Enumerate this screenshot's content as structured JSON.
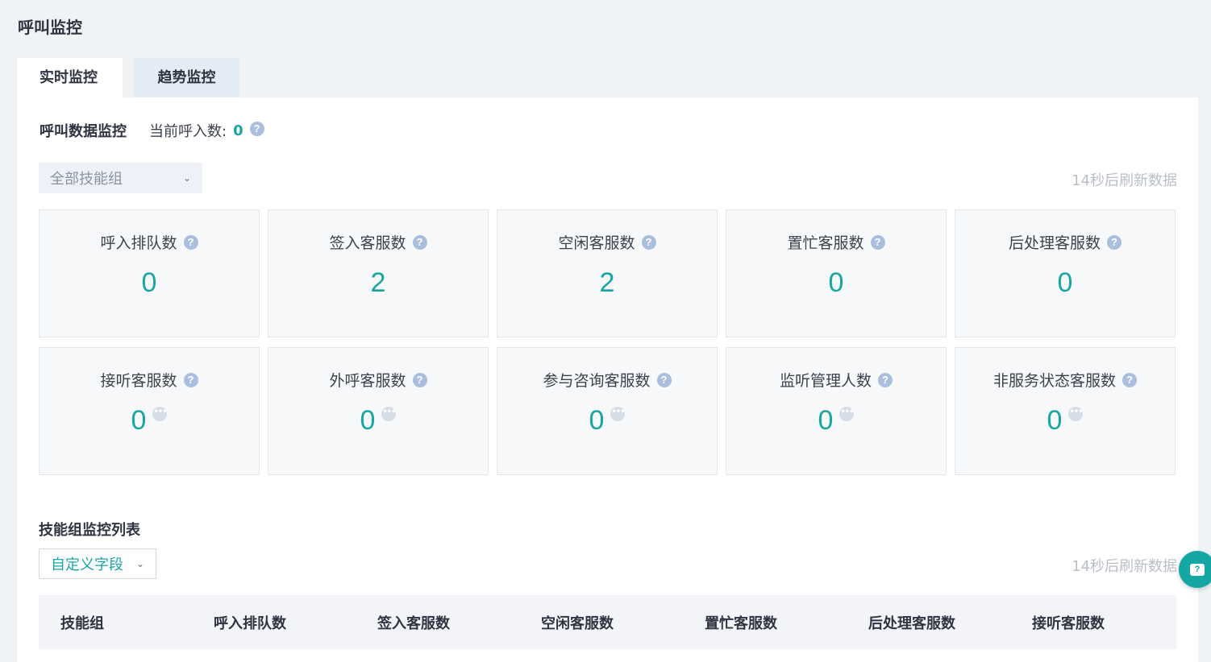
{
  "page": {
    "title": "呼叫监控"
  },
  "tabs": [
    {
      "label": "实时监控",
      "active": true
    },
    {
      "label": "趋势监控",
      "active": false
    }
  ],
  "monitor": {
    "section_title": "呼叫数据监控",
    "current_label": "当前呼入数:",
    "current_value": "0",
    "group_select": "全部技能组",
    "refresh_text": "14秒后刷新数据"
  },
  "cards": [
    {
      "label": "呼入排队数",
      "value": "0"
    },
    {
      "label": "签入客服数",
      "value": "2"
    },
    {
      "label": "空闲客服数",
      "value": "2"
    },
    {
      "label": "置忙客服数",
      "value": "0"
    },
    {
      "label": "后处理客服数",
      "value": "0"
    },
    {
      "label": "接听客服数",
      "value": "0"
    },
    {
      "label": "外呼客服数",
      "value": "0"
    },
    {
      "label": "参与咨询客服数",
      "value": "0"
    },
    {
      "label": "监听管理人数",
      "value": "0"
    },
    {
      "label": "非服务状态客服数",
      "value": "0"
    }
  ],
  "group_list": {
    "title": "技能组监控列表",
    "custom_fields": "自定义字段",
    "refresh_text": "14秒后刷新数据",
    "columns": [
      "技能组",
      "呼入排队数",
      "签入客服数",
      "空闲客服数",
      "置忙客服数",
      "后处理客服数",
      "接听客服数"
    ]
  },
  "icons": {
    "question": "question-circle-icon",
    "more": "more-dots-icon",
    "help": "help-chat-icon"
  },
  "colors": {
    "accent": "#18a6a0",
    "page_bg": "#eff3f5",
    "card_bg": "#f7f8fa",
    "tab_inactive": "#e3ebf5"
  }
}
